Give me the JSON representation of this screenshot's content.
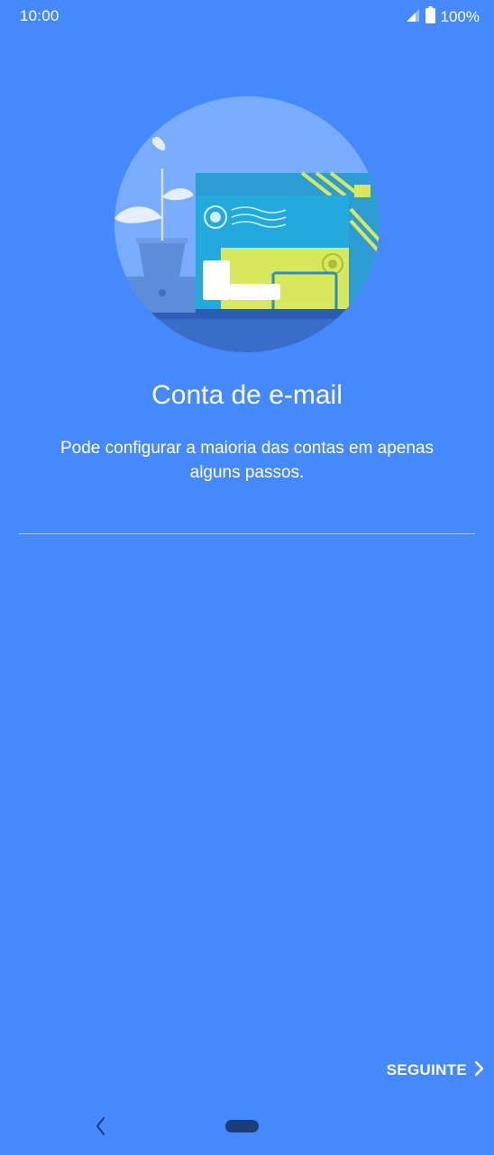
{
  "status_bar": {
    "time": "10:00",
    "battery_text": "100%",
    "icons": [
      "signal-icon",
      "battery-icon"
    ]
  },
  "main": {
    "illustration": "email-envelope-illustration",
    "title": "Conta de e-mail",
    "subtitle": "Pode configurar a maioria das contas em apenas alguns passos."
  },
  "footer": {
    "next_label": "SEGUINTE",
    "next_icon": "chevron-right-icon"
  },
  "nav_bar": {
    "icons": [
      "back-icon",
      "home-pill-icon"
    ]
  },
  "colors": {
    "background": "#4589fd",
    "text": "#ffffff"
  }
}
